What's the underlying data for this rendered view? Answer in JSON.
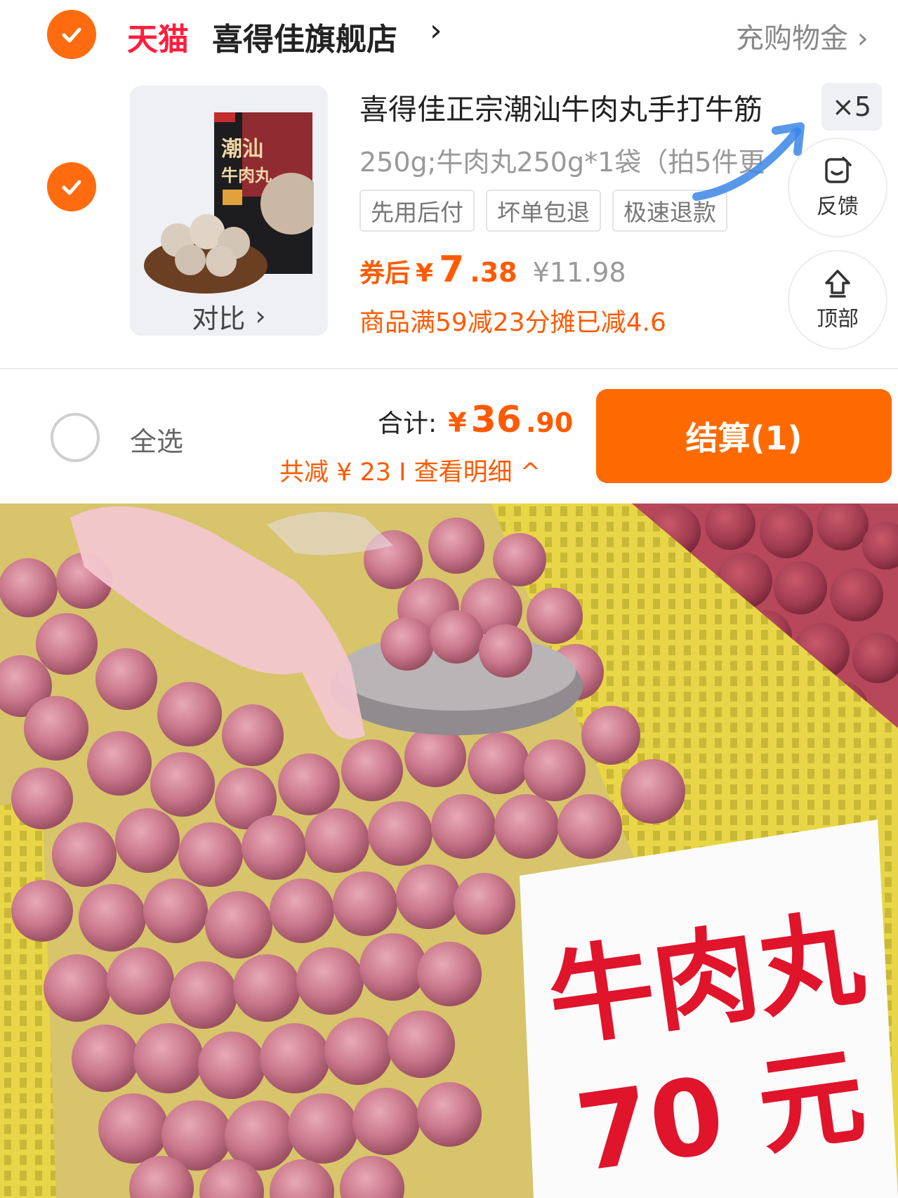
{
  "store": {
    "platform_tag": "天猫",
    "name": "喜得佳旗舰店",
    "chevron": "›",
    "shopping_gold": "充购物金 ›"
  },
  "product": {
    "title": "喜得佳正宗潮汕牛肉丸手打牛筋",
    "quantity": "×5",
    "sku": "250g;牛肉丸250g*1袋（拍5件更",
    "tags": [
      "先用后付",
      "坏单包退",
      "极速退款"
    ],
    "price_label": "券后",
    "currency": "¥",
    "price_int": "7",
    "price_dec": ".38",
    "original_price": "¥11.98",
    "promo": "商品满59减23分摊已减4.6",
    "compare_label": "对比",
    "compare_chevron": "›",
    "package_text": [
      "潮汕",
      "牛肉丸"
    ]
  },
  "floating": {
    "feedback": "反馈",
    "top": "顶部"
  },
  "footer": {
    "select_all": "全选",
    "total_label": "合计:",
    "currency": "¥",
    "total_int": "36",
    "total_dec": ".90",
    "savings": "共减 ¥ 23 I 查看明细 ^",
    "checkout": "结算(1)"
  },
  "photo": {
    "sign_line1": "牛肉丸",
    "sign_line2": "70 元"
  },
  "colors": {
    "accent": "#ff6a00",
    "tmall_red": "#ff1e3c",
    "sign_red": "#e0142b",
    "basket_yellow": "#e9d84a"
  }
}
